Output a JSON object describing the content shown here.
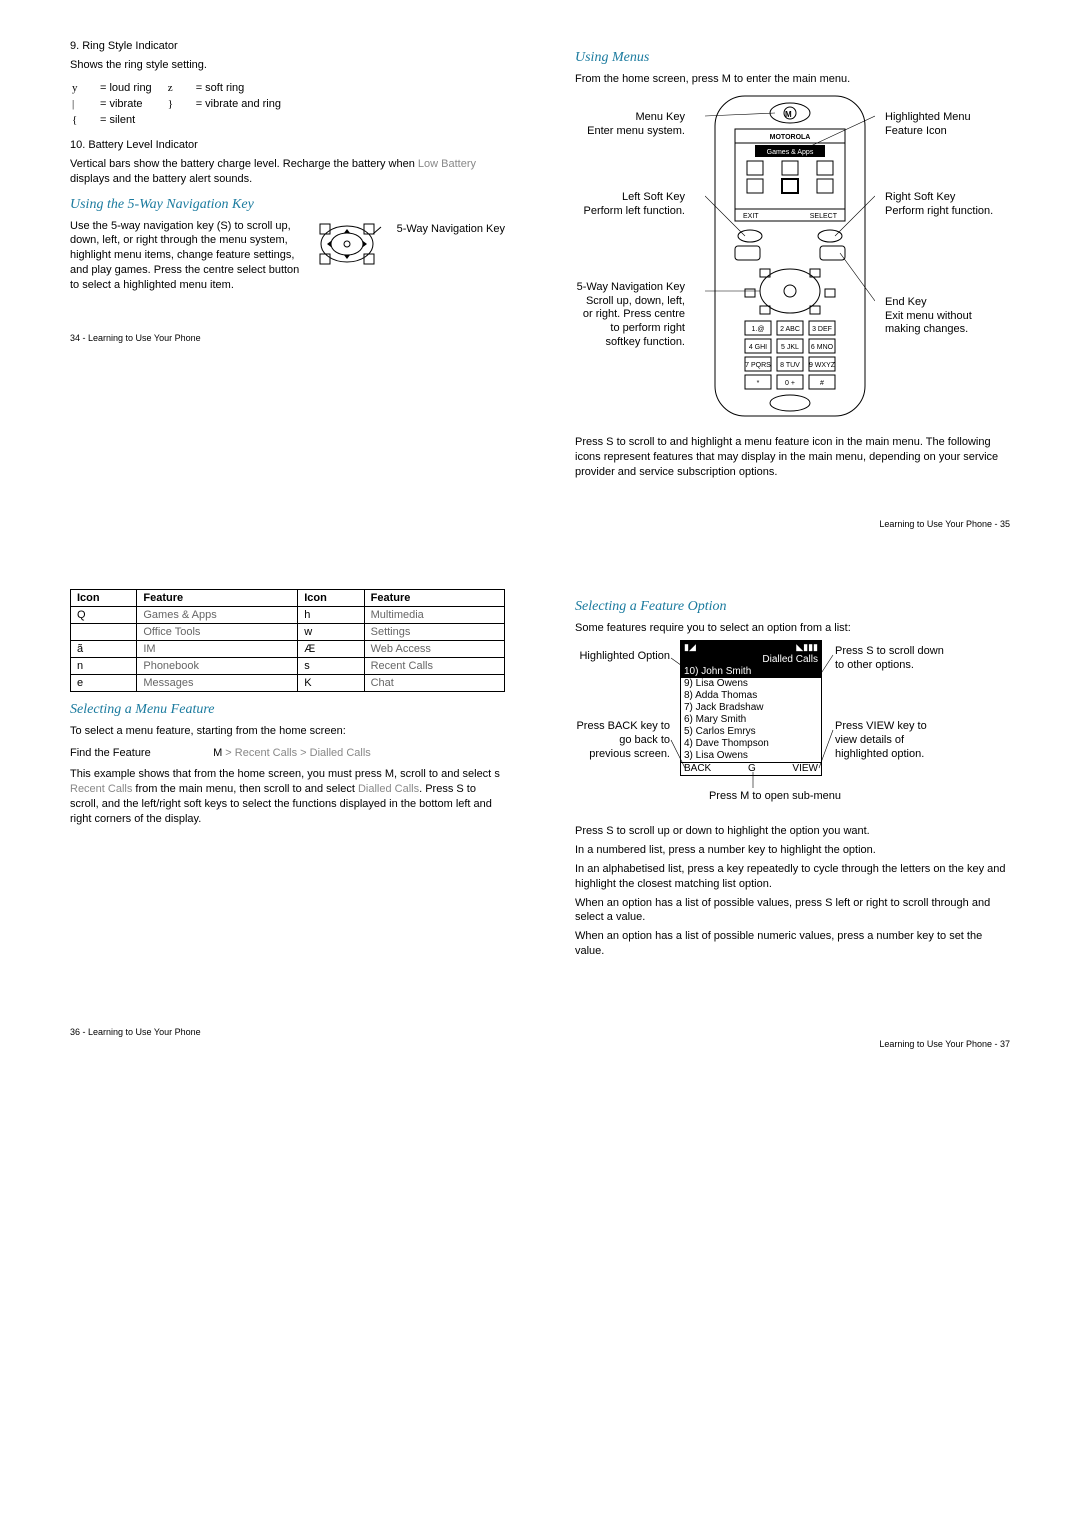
{
  "p34": {
    "h_ring": "9. Ring Style Indicator",
    "ring_desc": "Shows the ring style setting.",
    "ring": {
      "r1s": "y",
      "r1t": "= loud ring",
      "r2s": "z",
      "r2t": "= soft ring",
      "r3s": "|",
      "r3t": "= vibrate",
      "r4s": "}",
      "r4t": "= vibrate and ring",
      "r5s": "{",
      "r5t": "= silent"
    },
    "h_batt": "10. Battery Level Indicator",
    "batt_desc_a": "Vertical bars show the battery charge level. Recharge the battery when ",
    "batt_desc_b": "Low Battery",
    "batt_desc_c": " displays and the battery alert sounds.",
    "h_nav": "Using the 5-Way Navigation Key",
    "nav_desc": "Use the 5-way navigation key (S) to scroll up, down, left, or right through the menu system, highlight menu items, change feature settings, and play games. Press the centre select button to select a highlighted menu item.",
    "nav_label": "5-Way Navigation Key",
    "footer": "34 - Learning to Use Your Phone"
  },
  "p35": {
    "h": "Using Menus",
    "intro_a": "From the home screen, press ",
    "intro_b": "M",
    "intro_c": " to enter the main menu.",
    "labels": {
      "menu_key": "Menu Key",
      "menu_key2": "Enter menu system.",
      "hl": "Highlighted Menu Feature Icon",
      "lsk": "Left Soft Key",
      "lsk2": "Perform left function.",
      "rsk": "Right Soft Key",
      "rsk2": "Perform right function.",
      "nav": "5-Way Navigation Key",
      "nav2": "Scroll up, down, left, or right. Press centre to perform right softkey function.",
      "end": "End Key",
      "end2": "Exit menu without making changes."
    },
    "screen": {
      "title": "Games & Apps",
      "exit": "EXIT",
      "select": "SELECT"
    },
    "para": "Press S to scroll to and highlight a menu feature icon in the main menu. The following icons represent features that may display in the main menu, depending on your service provider and service subscription options.",
    "footer": "Learning to Use Your Phone - 35"
  },
  "p36": {
    "tbl": {
      "h1": "Icon",
      "h2": "Feature",
      "h3": "Icon",
      "h4": "Feature",
      "r1a": "Q",
      "r1b": "Games & Apps",
      "r1c": "h",
      "r1d": "Multimedia",
      "r2a": "",
      "r2b": "Office Tools",
      "r2c": "w",
      "r2d": "Settings",
      "r3a": "ã",
      "r3b": "IM",
      "r3c": "Æ",
      "r3d": "Web Access",
      "r4a": "n",
      "r4b": "Phonebook",
      "r4c": "s",
      "r4d": "Recent Calls",
      "r5a": "e",
      "r5b": "Messages",
      "r5c": "K",
      "r5d": "Chat"
    },
    "h_sel": "Selecting a Menu Feature",
    "sel_p1": "To select a menu feature, starting from the home screen:",
    "find_label": "Find the Feature",
    "find_seq_a": "M",
    "find_seq_b": " > Recent Calls > Dialled Calls",
    "sel_p2_a": "This example shows that from the home screen, you must press ",
    "sel_p2_b": "M",
    "sel_p2_c": ", scroll to and select ",
    "sel_p2_d": "s",
    "sel_p2_e": " Recent Calls",
    "sel_p2_f": " from the main menu, then scroll to and select ",
    "sel_p2_g": "Dialled Calls",
    "sel_p2_h": ". Press ",
    "sel_p2_i": "S",
    "sel_p2_j": " to scroll, and the left/right soft keys to select the functions displayed in the bottom left and right corners of the display.",
    "footer": "36 - Learning to Use Your Phone"
  },
  "p37": {
    "h": "Selecting a Feature Option",
    "intro": "Some features require you to select an option from a list:",
    "screen": {
      "sig": "▮◢",
      "batt": "◣▮▮▮",
      "title": "Dialled Calls",
      "rows": [
        "10) John Smith",
        "9) Lisa Owens",
        "8) Adda Thomas",
        "7) Jack Bradshaw",
        "6) Mary Smith",
        "5) Carlos Emrys",
        "4) Dave Thompson",
        "3) Lisa Owens"
      ],
      "back": "BACK",
      "mid": "G",
      "view": "VIEW"
    },
    "labels": {
      "hl": "Highlighted Option",
      "scroll_a": "Press ",
      "scroll_b": "S",
      "scroll_c": " to scroll down to other options.",
      "back_a": "Press BACK key to go back to previous screen.",
      "view_a": "Press VIEW key to view details of highlighted option.",
      "sub_a": "Press ",
      "sub_b": "M",
      "sub_c": " to open sub-menu"
    },
    "p1_a": "Press ",
    "p1_b": "S",
    "p1_c": " to scroll up or down to highlight the option you want.",
    "p2": "In a numbered list, press a number key to highlight the option.",
    "p3": "In an alphabetised list, press a key repeatedly to cycle through the letters on the key and highlight the closest matching list option.",
    "p4_a": "When an option has a list of possible values, press ",
    "p4_b": "S",
    "p4_c": " left or right to scroll through and select a value.",
    "p5": "When an option has a list of possible numeric values, press a number key to set the value.",
    "footer": "Learning to Use Your Phone - 37"
  }
}
